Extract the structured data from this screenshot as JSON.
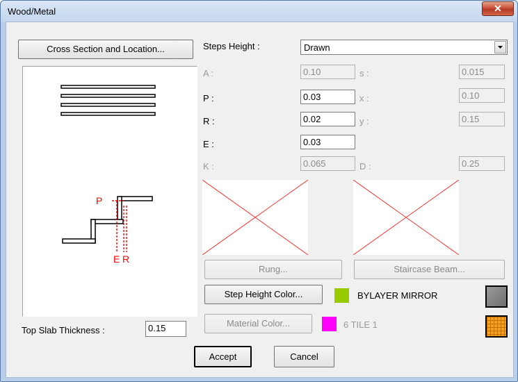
{
  "window": {
    "title": "Wood/Metal",
    "close_glyph": "✕"
  },
  "buttons": {
    "cross_section": "Cross Section and Location...",
    "rung": "Rung...",
    "staircase_beam": "Staircase Beam...",
    "step_height_color": "Step Height Color...",
    "material_color": "Material Color...",
    "accept": "Accept",
    "cancel": "Cancel"
  },
  "steps_height": {
    "label": "Steps Height :",
    "value": "Drawn"
  },
  "params": {
    "A": {
      "label": "A :",
      "value": "0.10"
    },
    "P": {
      "label": "P :",
      "value": "0.03"
    },
    "R": {
      "label": "R :",
      "value": "0.02"
    },
    "E": {
      "label": "E :",
      "value": "0.03"
    },
    "K": {
      "label": "K :",
      "value": "0.065"
    },
    "s": {
      "label": "s :",
      "value": "0.015"
    },
    "x": {
      "label": "x :",
      "value": "0.10"
    },
    "y": {
      "label": "y :",
      "value": "0.15"
    },
    "D": {
      "label": "D :",
      "value": "0.25"
    }
  },
  "step_height_color": {
    "text": "BYLAYER MIRROR",
    "color": "#99cc00"
  },
  "material_color": {
    "text": "6 TILE 1",
    "color": "#ff00ff"
  },
  "top_slab": {
    "label": "Top Slab Thickness :",
    "value": "0.15"
  },
  "diagram": {
    "label_p": "P",
    "label_e": "E",
    "label_r": "R",
    "accent": "#ff0000"
  },
  "icons": {
    "step_height_icon": "gray-square-icon",
    "material_icon": "tile-pattern-icon"
  }
}
